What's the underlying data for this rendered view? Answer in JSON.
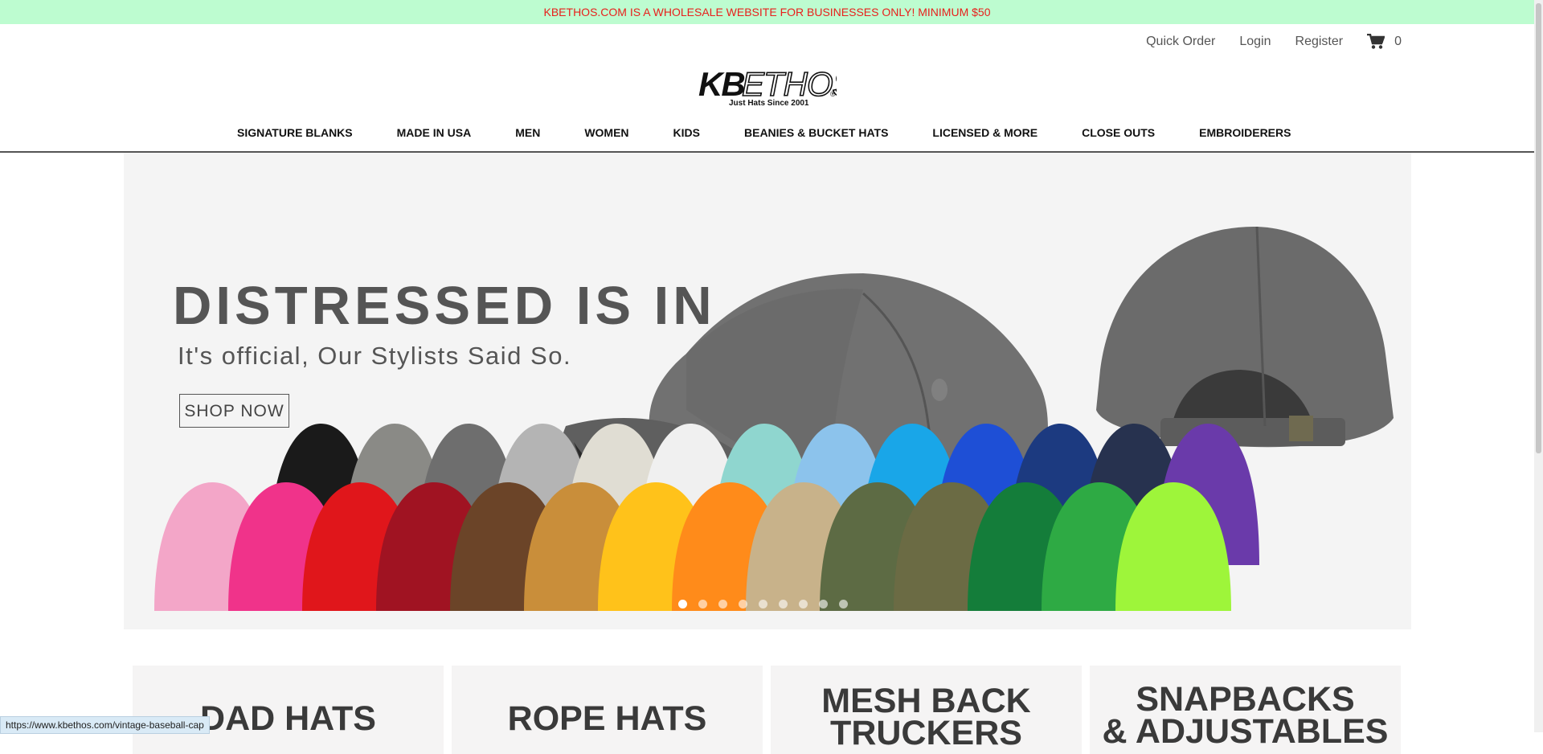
{
  "promo_text": "KBETHOS.COM IS A WHOLESALE WEBSITE FOR BUSINESSES ONLY! MINIMUM $50",
  "top_links": {
    "quick_order": "Quick Order",
    "login": "Login",
    "register": "Register",
    "cart_count": "0"
  },
  "logo": {
    "text": "KBETHOS",
    "tagline": "Just Hats Since 2001"
  },
  "nav": [
    "SIGNATURE BLANKS",
    "MADE IN USA",
    "MEN",
    "WOMEN",
    "KIDS",
    "BEANIES & BUCKET HATS",
    "LICENSED & MORE",
    "CLOSE OUTS",
    "EMBROIDERERS"
  ],
  "hero": {
    "title": "DISTRESSED IS IN",
    "subtitle": "It's official, Our Stylists Said So.",
    "cta": "SHOP NOW",
    "slide_count": 9,
    "active_slide": 1,
    "cap_colors_back": [
      "#1a1a1a",
      "#8a8a86",
      "#6e6e6e",
      "#b4b4b4",
      "#e0ddd3",
      "#f0f0f0",
      "#8fd6cf",
      "#8cc3ec",
      "#19a6e8",
      "#1e4fd6",
      "#1c3a80",
      "#27324f",
      "#6a3aaa"
    ],
    "cap_colors_front": [
      "#f3a6c8",
      "#f0338a",
      "#e0161b",
      "#a01322",
      "#6b4428",
      "#c98e3a",
      "#ffc21a",
      "#ff8b1a",
      "#c8b28a",
      "#5d6b44",
      "#6b6b44",
      "#147d3a",
      "#2eaa44",
      "#9ef53a"
    ]
  },
  "tiles": [
    {
      "title": "DAD HATS"
    },
    {
      "title": "ROPE HATS"
    },
    {
      "title": "MESH BACK\nTRUCKERS"
    },
    {
      "title": "SNAPBACKS\n& ADJUSTABLES"
    }
  ],
  "status_url": "https://www.kbethos.com/vintage-baseball-cap"
}
